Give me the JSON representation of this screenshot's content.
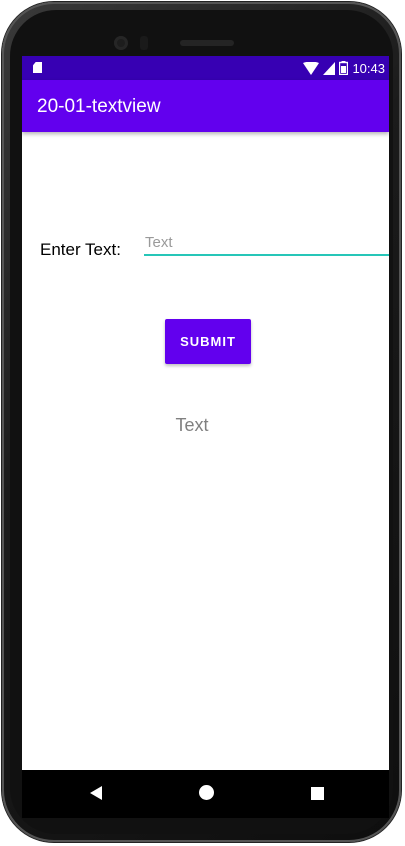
{
  "status_bar": {
    "time": "10:43"
  },
  "app_bar": {
    "title": "20-01-textview"
  },
  "form": {
    "label": "Enter Text:",
    "input_placeholder": "Text",
    "input_value": "",
    "submit_label": "SUBMIT"
  },
  "output": {
    "text": "Text"
  },
  "colors": {
    "primary": "#6200ee",
    "primary_dark": "#3700b3",
    "accent": "#26c6b8"
  },
  "icons": {
    "status": [
      "sd-card-icon",
      "wifi-icon",
      "signal-icon",
      "battery-icon"
    ],
    "nav": [
      "back-icon",
      "home-icon",
      "recents-icon"
    ]
  }
}
